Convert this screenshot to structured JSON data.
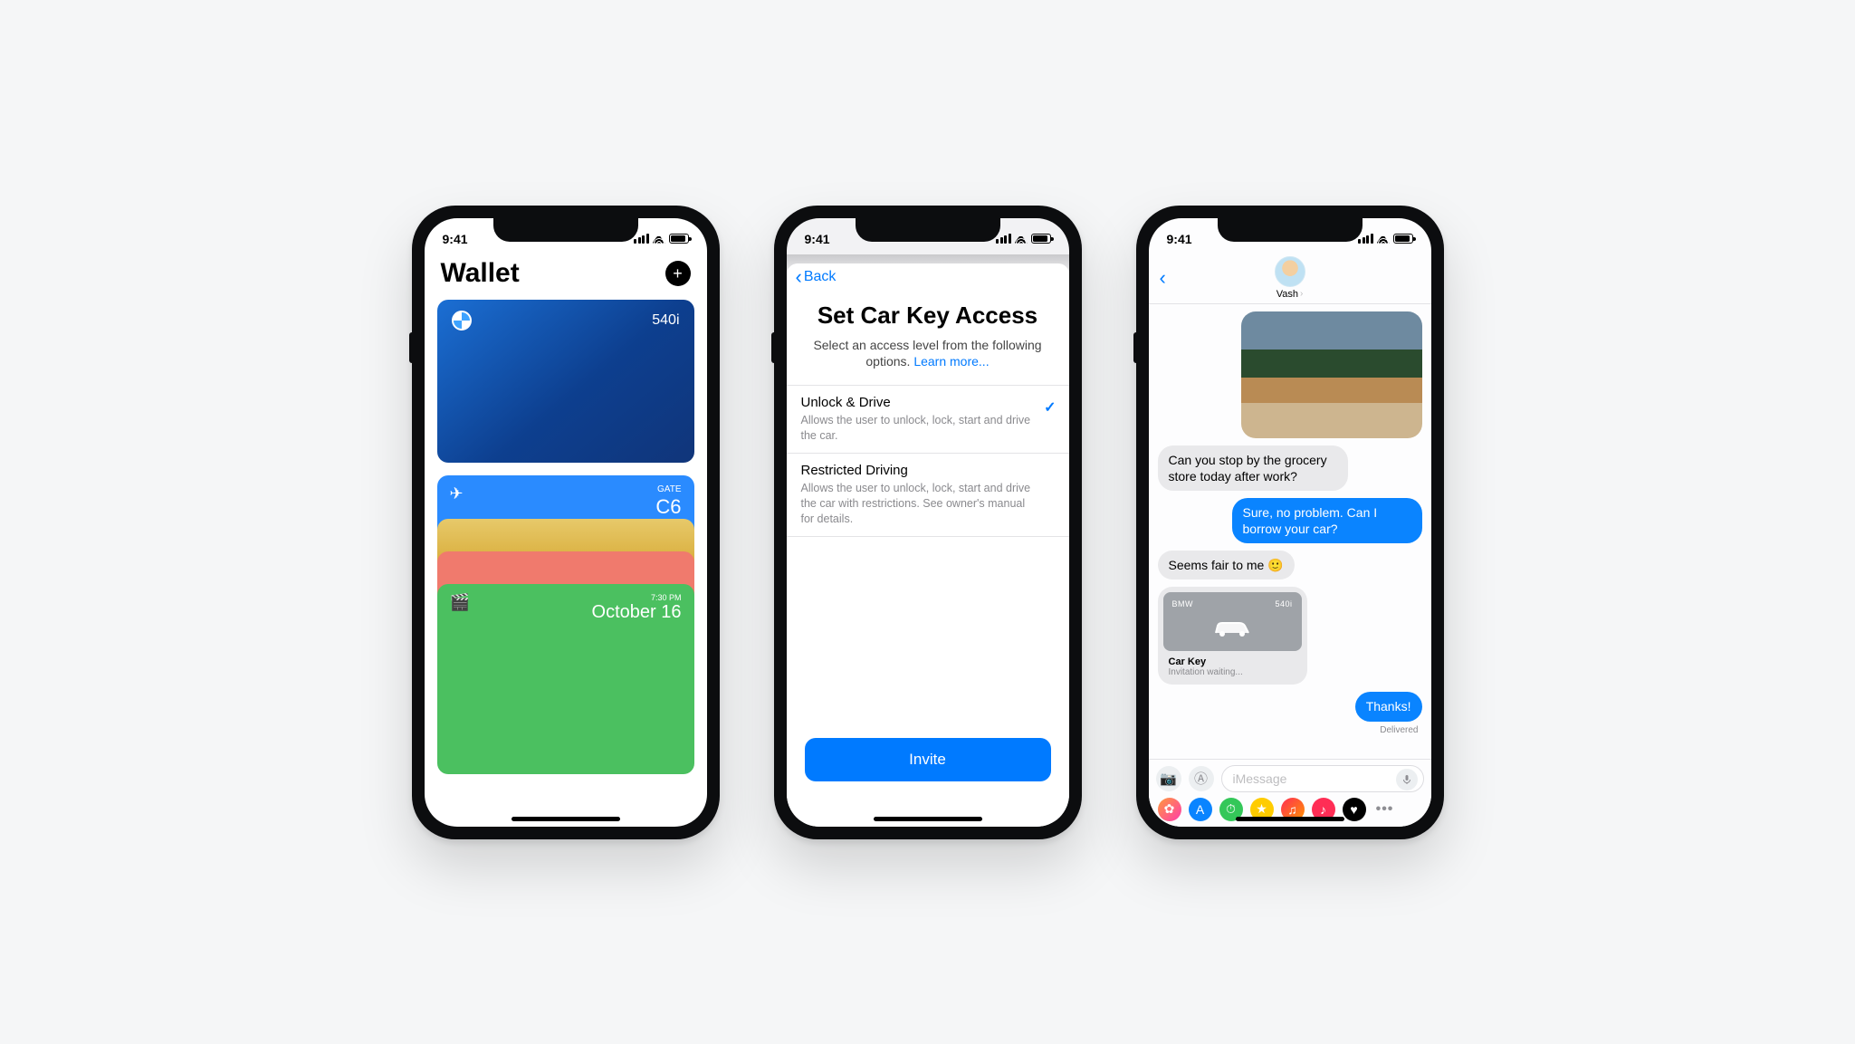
{
  "status": {
    "time": "9:41"
  },
  "phone1": {
    "title": "Wallet",
    "card_bmw": {
      "brand": "BMW",
      "label": "540i"
    },
    "boarding": {
      "gate_label": "GATE",
      "gate": "C6"
    },
    "event": {
      "time": "7:30 PM",
      "date": "October 16"
    }
  },
  "phone2": {
    "back": "Back",
    "title": "Set Car Key Access",
    "subtitle": "Select an access level from the following options.",
    "learn_more": "Learn more...",
    "options": [
      {
        "title": "Unlock & Drive",
        "desc": "Allows the user to unlock, lock, start and drive the car.",
        "selected": true
      },
      {
        "title": "Restricted Driving",
        "desc": "Allows the user to unlock, lock, start and drive the car with restrictions. See owner's manual for details.",
        "selected": false
      }
    ],
    "invite": "Invite"
  },
  "phone3": {
    "contact": "Vash",
    "msg_in_1": "Can you stop by the grocery store today after work?",
    "msg_out_1": "Sure, no problem. Can I borrow your car?",
    "msg_in_2": "Seems fair to me 🙂",
    "carkey": {
      "brand": "BMW",
      "model": "540i",
      "title": "Car Key",
      "status": "Invitation waiting..."
    },
    "msg_out_2": "Thanks!",
    "delivered": "Delivered",
    "placeholder": "iMessage",
    "apps": [
      {
        "bg": "linear-gradient(135deg,#ff9a3c,#ff3cac)",
        "glyph": "✿"
      },
      {
        "bg": "#0a84ff",
        "glyph": "A"
      },
      {
        "bg": "#34c759",
        "glyph": "⏱"
      },
      {
        "bg": "#ffcc00",
        "glyph": "★"
      },
      {
        "bg": "linear-gradient(135deg,#ff2d55,#ff9500)",
        "glyph": "♫"
      },
      {
        "bg": "#ff2d55",
        "glyph": "♪"
      },
      {
        "bg": "#000",
        "glyph": "♥"
      }
    ]
  }
}
